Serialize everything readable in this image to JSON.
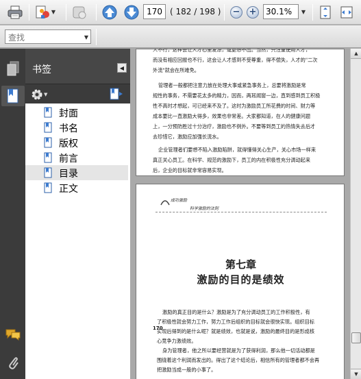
{
  "toolbar": {
    "page_number": "170",
    "page_count": "( 182 / 198 )",
    "zoom": "30.1%"
  },
  "find": {
    "placeholder": "查找"
  },
  "bookmarks": {
    "title": "书签",
    "items": [
      {
        "label": "封面"
      },
      {
        "label": "书名"
      },
      {
        "label": "版权"
      },
      {
        "label": "前言"
      },
      {
        "label": "目录",
        "selected": true
      },
      {
        "label": "正文"
      }
    ]
  },
  "document": {
    "page1_lines": [
      "人不行，这样会让人才心里发凉，或更想不出。当然，只注重使用人才，",
      "而没有相应回报也不行，这会让人才感到不受尊重，得不偿失，人才的\"二次",
      "外流\"就会在所难免。",
      "管理者一般都把注意力放在处理大事或紧急事务上，总要将激励是常",
      "规性的事务，不需要花太多的精力，因而，两耳闻窗一边，直到感到员工积极",
      "性不高时才想起，可已经来不及了。这时为激励员工所花费的时间、财力等",
      "成本要比一直激励大得多，效果也非常差。大家都知道，在人的健康问题",
      "上，一分预防胜过十分治疗，激励也不例外。不要等到员工的热情失去后才",
      "去珍惜它，激励应加强长流水。",
      "企业管理者们要想不陷入激励陷阱，就得懂得关心生产，关心市场一样来",
      "真正关心员工。在科学、规范的激励下，员工的内在积极性充分调动起来",
      "后，企业的目标就非常容易实现。"
    ],
    "page2_header_1": "成功激励",
    "page2_header_2": "科学激励的法则",
    "chapter_number": "第七章",
    "chapter_title": "激励的目的是绩效",
    "side_page_number": "170",
    "page2_lines": [
      "激励的真正目的是什么？激励是为了充分调动员工的工作积极性，有",
      "了积极性就会努力工作，努力工作后组织的目标就会很快实现。组织目标",
      "实现后得到的是什么呢？就是绩效，也就是说，激励的最终目的是形成核",
      "心竞争力激绩效。",
      "身为管理者，他之所以要经营就是为了获得利润，那么他一切活动都是",
      "围绕着这个利润而发出的。得出了这个结论后，相信所有的管理者都不会再",
      "把激励当成一般的小事了。"
    ]
  },
  "colors": {
    "accent": "#4a8ad4",
    "panel_bg": "#3b3b3b",
    "doc_bg": "#a9a9a9"
  }
}
